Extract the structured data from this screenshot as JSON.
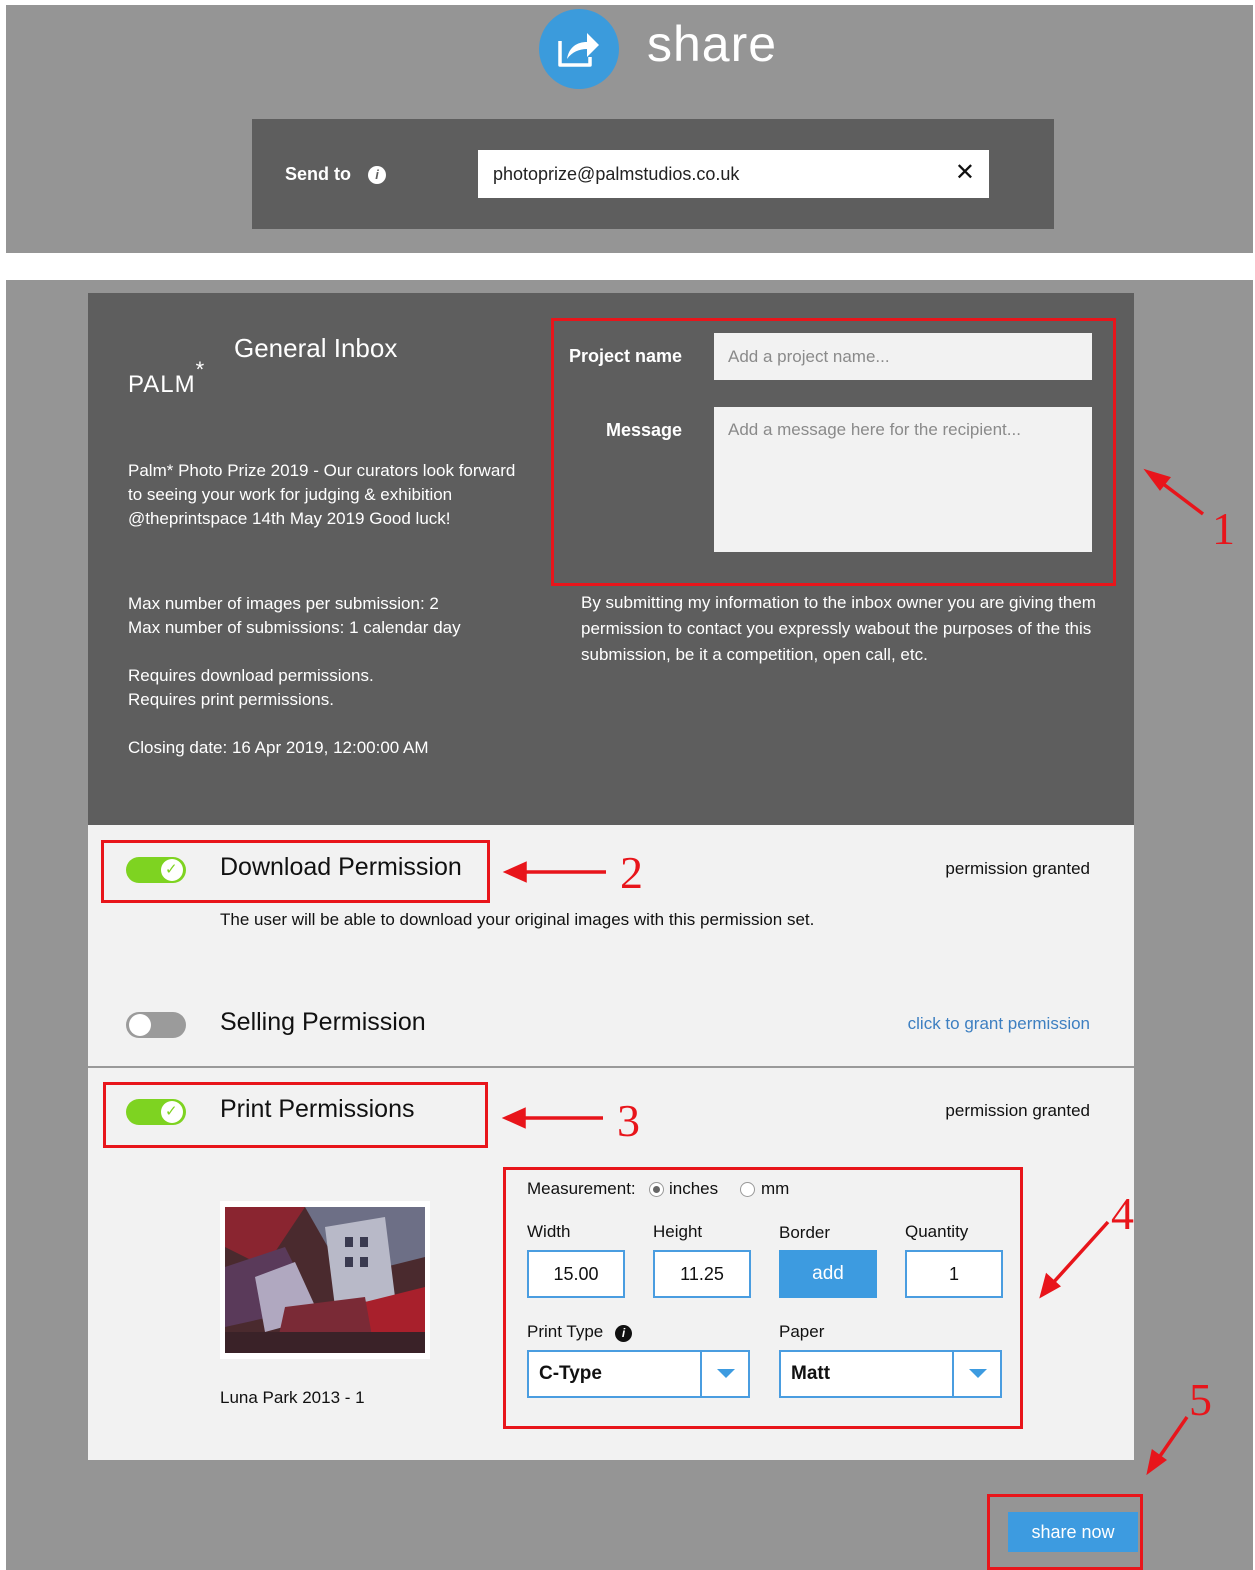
{
  "share": {
    "title": "share",
    "icon": "share-arrow-icon",
    "send_to_label": "Send to",
    "send_to_value": "photoprize@palmstudios.co.uk",
    "clear_symbol": "✕"
  },
  "inbox": {
    "logo_text": "PALM",
    "logo_star": "*",
    "title": "General Inbox",
    "description": "Palm* Photo Prize 2019 - Our curators look forward to seeing your work for judging & exhibition @theprintspace 14th May 2019 Good luck!",
    "max_images": "Max number of images per submission: 2",
    "max_submissions": "Max number of submissions: 1 calendar day",
    "requires_download": "Requires download permissions.",
    "requires_print": "Requires print permissions.",
    "closing_date": "Closing date: 16 Apr 2019, 12:00:00 AM"
  },
  "form": {
    "project_label": "Project name",
    "project_placeholder": "Add a project name...",
    "message_label": "Message",
    "message_placeholder": "Add a message here for the recipient...",
    "consent": "By submitting my information to the inbox owner you are giving them permission to contact you expressly wabout the purposes of the this submission, be it a competition, open call, etc."
  },
  "permissions": {
    "download": {
      "title": "Download Permission",
      "status": "permission granted",
      "description": "The user will be able to download your original images with this permission set.",
      "enabled": true
    },
    "selling": {
      "title": "Selling Permission",
      "link": "click to grant permission",
      "enabled": false
    },
    "print": {
      "title": "Print Permissions",
      "status": "permission granted",
      "enabled": true
    }
  },
  "print_options": {
    "measurement_label": "Measurement:",
    "unit_options": [
      "inches",
      "mm"
    ],
    "selected_unit": "inches",
    "width_label": "Width",
    "width_value": "15.00",
    "height_label": "Height",
    "height_value": "11.25",
    "border_label": "Border",
    "border_button": "add",
    "quantity_label": "Quantity",
    "quantity_value": "1",
    "print_type_label": "Print Type",
    "print_type_value": "C-Type",
    "paper_label": "Paper",
    "paper_value": "Matt"
  },
  "image": {
    "caption": "Luna Park 2013 - 1"
  },
  "actions": {
    "share_now": "share now"
  },
  "annotations": [
    "1",
    "2",
    "3",
    "4",
    "5"
  ],
  "colors": {
    "accent": "#3d9be0",
    "toggle_on": "#7ed321",
    "annotation_red": "#e8151b",
    "dark_panel": "#5e5e5e",
    "page_grey": "#959595"
  }
}
